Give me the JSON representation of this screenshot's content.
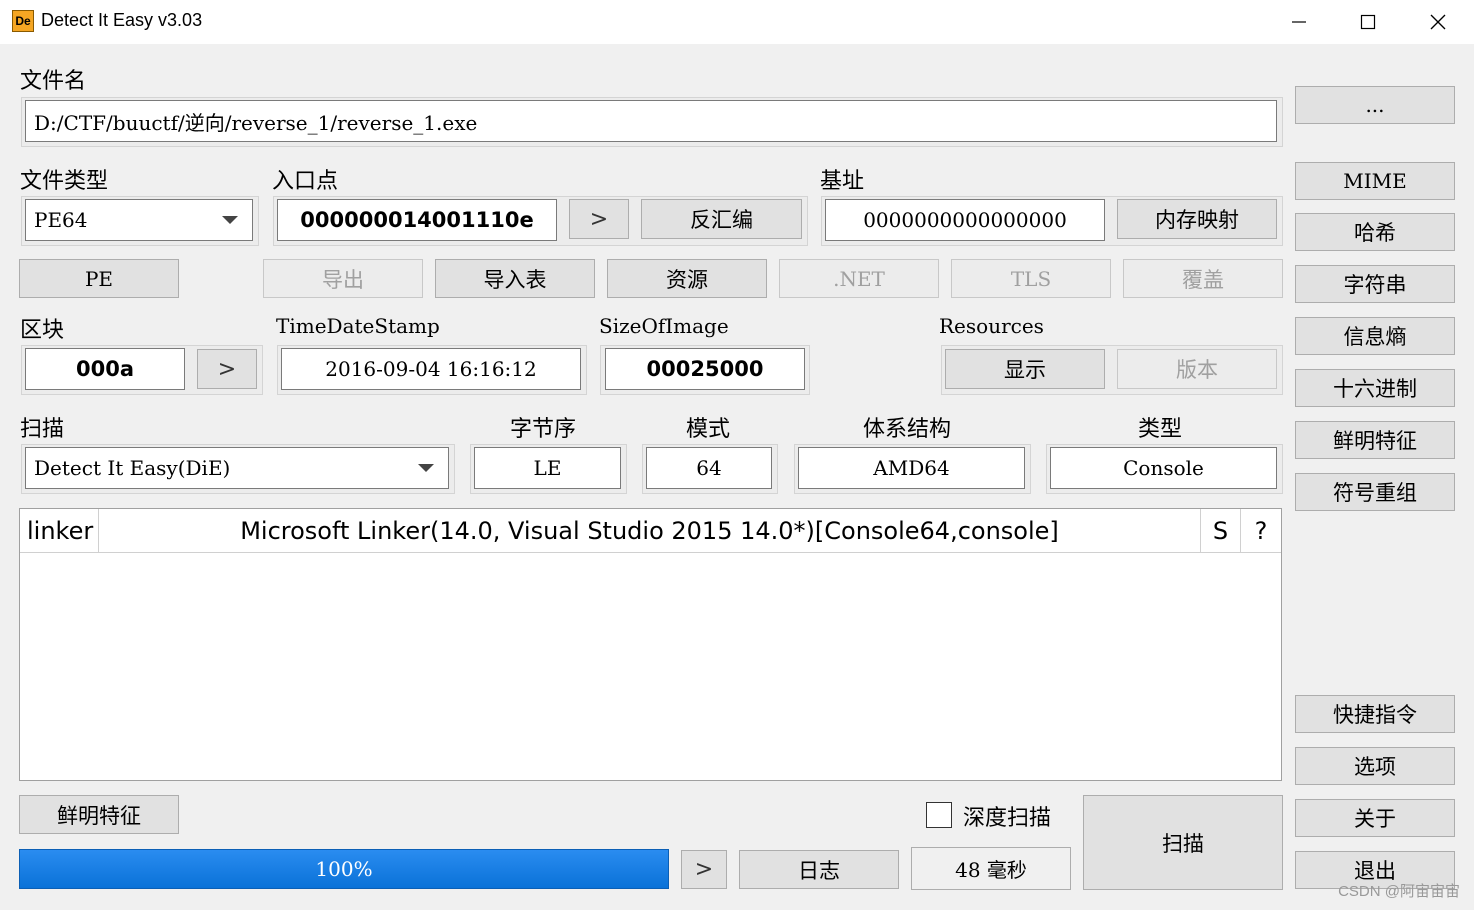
{
  "window": {
    "icon_text": "De",
    "title": "Detect It Easy v3.03",
    "minimize_glyph": "—",
    "maximize_glyph": "☐",
    "close_glyph": "✕"
  },
  "file": {
    "label": "文件名",
    "path": "D:/CTF/buuctf/逆向/reverse_1/reverse_1.exe",
    "browse_label": "..."
  },
  "file_type": {
    "label": "文件类型",
    "value": "PE64"
  },
  "entry_point": {
    "label": "入口点",
    "value": "000000014001110e",
    "disasm_label": "反汇编"
  },
  "base_address": {
    "label": "基址",
    "value": "0000000000000000",
    "memmap_label": "内存映射"
  },
  "buttons_row": {
    "pe": "PE",
    "export": "导出",
    "import": "导入表",
    "resources": "资源",
    "net": ".NET",
    "tls": "TLS",
    "overlay": "覆盖"
  },
  "sections": {
    "label": "区块",
    "value": "000a"
  },
  "timestamp": {
    "label": "TimeDateStamp",
    "value": "2016-09-04 16:16:12"
  },
  "size_of_image": {
    "label": "SizeOfImage",
    "value": "00025000"
  },
  "resources": {
    "label": "Resources",
    "show_label": "显示",
    "version_label": "版本"
  },
  "scan": {
    "label": "扫描",
    "engine": "Detect It Easy(DiE)",
    "endianness_label": "字节序",
    "endianness": "LE",
    "mode_label": "模式",
    "mode": "64",
    "arch_label": "体系结构",
    "arch": "AMD64",
    "type_label": "类型",
    "type": "Console"
  },
  "results": [
    {
      "type": "linker",
      "name": "Microsoft Linker(14.0, Visual Studio 2015 14.0*)[Console64,console]",
      "s": "S",
      "q": "?"
    }
  ],
  "side_buttons": {
    "mime": "MIME",
    "hash": "哈希",
    "strings": "字符串",
    "entropy": "信息熵",
    "hex": "十六进制",
    "signatures": "鲜明特征",
    "demangle": "符号重组",
    "shortcuts": "快捷指令",
    "options": "选项",
    "about": "关于",
    "exit": "退出"
  },
  "bottom": {
    "signatures_label": "鲜明特征",
    "deep_scan_label": "深度扫描",
    "deep_scan_checked": false,
    "progress": 100,
    "progress_text": "100%",
    "log_label": "日志",
    "time_text": "48 毫秒",
    "scan_label": "扫描"
  },
  "watermark": "CSDN @阿宙宙宙"
}
